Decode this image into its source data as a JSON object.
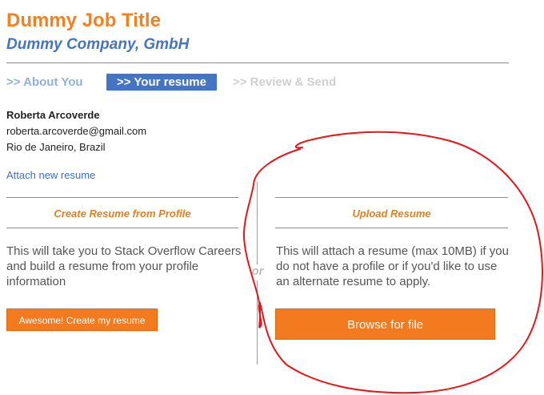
{
  "job": {
    "title": "Dummy Job Title",
    "company": "Dummy Company, GmbH"
  },
  "steps": [
    {
      "label": ">> About You",
      "state": "visited"
    },
    {
      "label": ">> Your resume",
      "state": "active"
    },
    {
      "label": ">> Review & Send",
      "state": "upcoming"
    }
  ],
  "applicant": {
    "name": "Roberta Arcoverde",
    "email": "roberta.arcoverde@gmail.com",
    "location": "Rio de Janeiro, Brazil"
  },
  "attach_link": "Attach new resume",
  "left_section": {
    "title": "Create Resume from Profile",
    "description": "This will take you to Stack Overflow Careers and build a resume from your profile information",
    "button": "Awesome! Create my resume"
  },
  "divider_label": "or",
  "right_section": {
    "title": "Upload Resume",
    "description": "This will attach a resume (max 10MB) if you do not have a profile or if you'd like to use an alternate resume to apply.",
    "button": "Browse for file"
  },
  "colors": {
    "accent_orange": "#f47a1f",
    "brand_blue": "#4574c2",
    "annotation_red": "#e8151b"
  }
}
